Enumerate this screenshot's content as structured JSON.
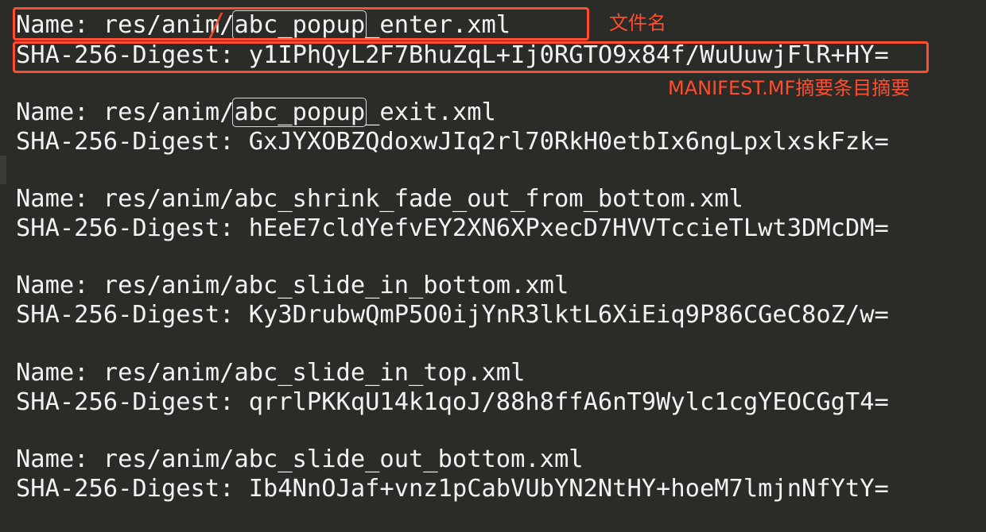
{
  "file_view": {
    "entries": [
      {
        "name_label": "Name:",
        "name_prefix": "res/anim/",
        "name_highlight": "abc_popup",
        "name_suffix": "_enter.xml",
        "digest_label": "SHA-256-Digest:",
        "digest_value": "y1IPhQyL2F7BhuZqL+Ij0RGTO9x84f/WuUuwjFlR+HY="
      },
      {
        "name_label": "Name:",
        "name_prefix": "res/anim/",
        "name_highlight": "abc_popup",
        "name_suffix": "_exit.xml",
        "digest_label": "SHA-256-Digest:",
        "digest_value": "GxJYXOBZQdoxwJIq2rl70RkH0etbIx6ngLpxlxskFzk="
      },
      {
        "name_label": "Name:",
        "name_prefix": "res/anim/",
        "name_highlight": "",
        "name_suffix": "abc_shrink_fade_out_from_bottom.xml",
        "digest_label": "SHA-256-Digest:",
        "digest_value": "hEeE7cldYefvEY2XN6XPxecD7HVVTccieTLwt3DMcDM="
      },
      {
        "name_label": "Name:",
        "name_prefix": "res/anim/",
        "name_highlight": "",
        "name_suffix": "abc_slide_in_bottom.xml",
        "digest_label": "SHA-256-Digest:",
        "digest_value": "Ky3DrubwQmP5O0ijYnR3lktL6XiEiq9P86CGeC8oZ/w="
      },
      {
        "name_label": "Name:",
        "name_prefix": "res/anim/",
        "name_highlight": "",
        "name_suffix": "abc_slide_in_top.xml",
        "digest_label": "SHA-256-Digest:",
        "digest_value": "qrrlPKKqU14k1qoJ/88h8ffA6nT9Wylc1cgYEOCGgT4="
      },
      {
        "name_label": "Name:",
        "name_prefix": "res/anim/",
        "name_highlight": "",
        "name_suffix": "abc_slide_out_bottom.xml",
        "digest_label": "SHA-256-Digest:",
        "digest_value": "Ib4NnOJaf+vnz1pCabVUbYN2NtHY+hoeM7lmjnNfYtY="
      }
    ]
  },
  "annotations": {
    "file_name_label": "文件名",
    "digest_label": "MANIFEST.MF摘要条目摘要",
    "accent_color": "#ff4d2d"
  },
  "theme": {
    "background": "#2b2b28",
    "text": "#f2f2f2"
  }
}
